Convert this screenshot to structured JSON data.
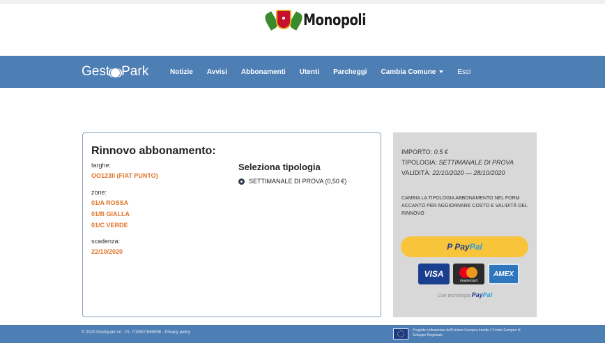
{
  "header": {
    "logo_text": "Monopoli"
  },
  "nav": {
    "brand_left": "Gest",
    "brand_right": "Park",
    "items": [
      "Notizie",
      "Avvisi",
      "Abbonamenti",
      "Utenti",
      "Parcheggi",
      "Cambia Comune",
      "Esci"
    ]
  },
  "renewal": {
    "title": "Rinnovo abbonamento:",
    "plates_label": "targhe:",
    "plate": "OO123II (FIAT PUNTO)",
    "zones_label": "zone:",
    "zones": [
      "01/A ROSSA",
      "01/B GIALLA",
      "01/C VERDE"
    ],
    "expiry_label": "scadenza:",
    "expiry": "22/10/2020",
    "select_title": "Seleziona tipologia",
    "option_label": "SETTIMANALE DI PROVA (0,50 €)",
    "option_selected": true
  },
  "payment": {
    "amount_label": "IMPORTO:",
    "amount": "0.5 €",
    "type_label": "TIPOLOGIA:",
    "type": "SETTIMANALE DI PROVA",
    "validity_label": "VALIDITÀ:",
    "validity": "22/10/2020 — 28/10/2020",
    "note": "CAMBIA LA TIPOLOGIA ABBONAMENTO NEL FORM ACCANTO PER AGGIORNARE COSTO E VALIDITÀ DEL RINNOVO",
    "paypal_p": "P",
    "paypal_pay": "Pay",
    "paypal_pal": "Pal",
    "card_visa": "VISA",
    "card_mc": "mastercard",
    "card_amex": "AMEX",
    "powered_by": "Con tecnologia",
    "powered_pay": "Pay",
    "powered_pal": "Pal"
  },
  "footer": {
    "copyright": "© 2020 Gestopark srl - P.I. IT30507860096 - Privacy policy",
    "eu_text": "Progetto cofinanziato dall'Unione Europea tramite il Fondo Europeo di Sviluppo Regionale"
  },
  "colors": {
    "navbar": "#4d7eb4",
    "accent_orange": "#e0752a",
    "panel_gray": "#d8d8d8",
    "paypal_yellow": "#f8c43a"
  }
}
